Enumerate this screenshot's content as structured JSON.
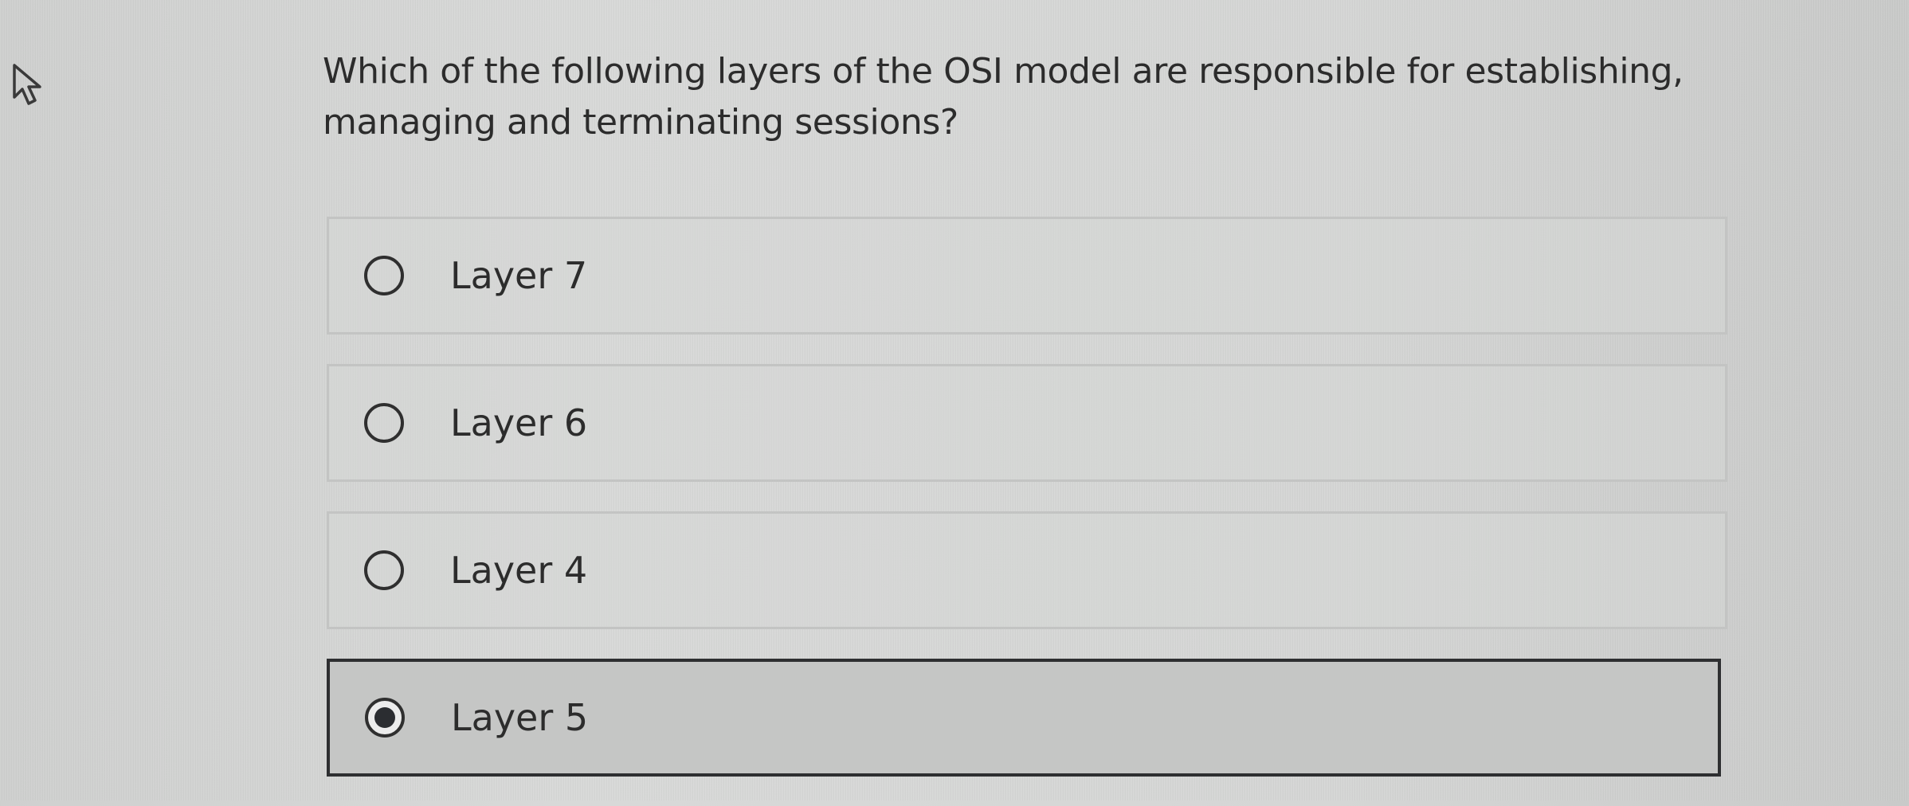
{
  "question": {
    "text": "Which of the following layers of the OSI model are responsible for establishing, managing and terminating sessions?"
  },
  "options": [
    {
      "label": "Layer 7",
      "selected": false
    },
    {
      "label": "Layer 6",
      "selected": false
    },
    {
      "label": "Layer 4",
      "selected": false
    },
    {
      "label": "Layer 5",
      "selected": true
    }
  ],
  "icons": {
    "cursor": "mouse-pointer-icon",
    "radio_unchecked": "radio-unchecked-icon",
    "radio_checked": "radio-checked-icon"
  },
  "colors": {
    "background": "#d5d6d5",
    "text": "#2c2c2c",
    "option_border": "#c3c4c3",
    "selected_border": "#2e2f31",
    "selected_fill": "#c5c6c5"
  }
}
